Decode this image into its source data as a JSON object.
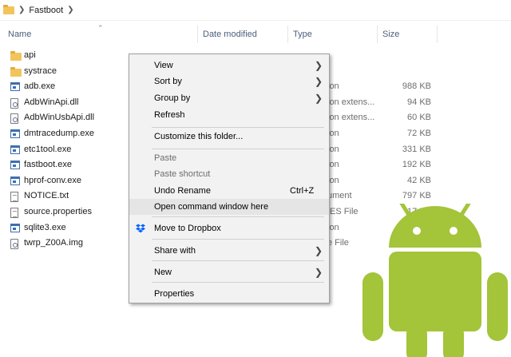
{
  "breadcrumb": {
    "folder": "Fastboot"
  },
  "columns": {
    "name": "Name",
    "date": "Date modified",
    "type": "Type",
    "size": "Size"
  },
  "files": [
    {
      "name": "api",
      "icon": "folder-icon",
      "type": "",
      "size": ""
    },
    {
      "name": "systrace",
      "icon": "folder-icon",
      "type": "",
      "size": ""
    },
    {
      "name": "adb.exe",
      "icon": "exe-icon",
      "type": "ion",
      "size": "988 KB"
    },
    {
      "name": "AdbWinApi.dll",
      "icon": "dll-icon",
      "type": "ion extens...",
      "size": "94 KB"
    },
    {
      "name": "AdbWinUsbApi.dll",
      "icon": "dll-icon",
      "type": "ion extens...",
      "size": "60 KB"
    },
    {
      "name": "dmtracedump.exe",
      "icon": "exe-icon",
      "type": "ion",
      "size": "72 KB"
    },
    {
      "name": "etc1tool.exe",
      "icon": "exe-icon",
      "type": "ion",
      "size": "331 KB"
    },
    {
      "name": "fastboot.exe",
      "icon": "exe-icon",
      "type": "ion",
      "size": "192 KB"
    },
    {
      "name": "hprof-conv.exe",
      "icon": "exe-icon",
      "type": "ion",
      "size": "42 KB"
    },
    {
      "name": "NOTICE.txt",
      "icon": "doc-icon",
      "type": "ument",
      "size": "797 KB"
    },
    {
      "name": "source.properties",
      "icon": "doc-icon",
      "type": "IES File",
      "size": "17 KB"
    },
    {
      "name": "sqlite3.exe",
      "icon": "exe-icon",
      "type": "ion",
      "size": "6"
    },
    {
      "name": "twrp_Z00A.img",
      "icon": "dll-icon",
      "type": "e File",
      "size": "1"
    }
  ],
  "context_menu": {
    "view": "View",
    "sort_by": "Sort by",
    "group_by": "Group by",
    "refresh": "Refresh",
    "customize": "Customize this folder...",
    "paste": "Paste",
    "paste_shortcut": "Paste shortcut",
    "undo_rename": "Undo Rename",
    "undo_shortcut": "Ctrl+Z",
    "open_cmd": "Open command window here",
    "move_dropbox": "Move to Dropbox",
    "share_with": "Share with",
    "new": "New",
    "properties": "Properties"
  },
  "colors": {
    "android_green": "#a4c439",
    "folder": "#f2c55c",
    "dropbox": "#0061ff"
  }
}
